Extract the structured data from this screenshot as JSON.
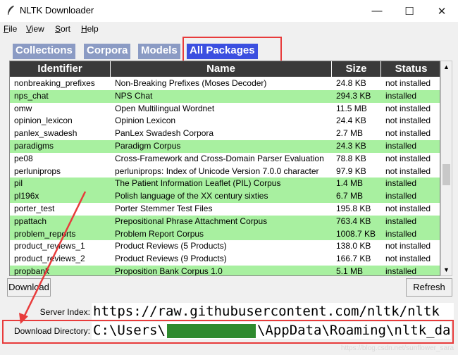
{
  "window": {
    "title": "NLTK Downloader",
    "controls": {
      "minimize": "—",
      "maximize": "☐",
      "close": "✕"
    }
  },
  "menu": [
    "File",
    "View",
    "Sort",
    "Help"
  ],
  "tabs": [
    {
      "label": "Collections",
      "active": false
    },
    {
      "label": "Corpora",
      "active": false
    },
    {
      "label": "Models",
      "active": false
    },
    {
      "label": "All Packages",
      "active": true
    }
  ],
  "table": {
    "columns": [
      "Identifier",
      "Name",
      "Size",
      "Status"
    ],
    "rows": [
      {
        "id": "nonbreaking_prefixes",
        "name": "Non-Breaking Prefixes (Moses Decoder)",
        "size": "24.8 KB",
        "status": "not installed"
      },
      {
        "id": "nps_chat",
        "name": "NPS Chat",
        "size": "294.3 KB",
        "status": "installed"
      },
      {
        "id": "omw",
        "name": "Open Multilingual Wordnet",
        "size": "11.5 MB",
        "status": "not installed"
      },
      {
        "id": "opinion_lexicon",
        "name": "Opinion Lexicon",
        "size": "24.4 KB",
        "status": "not installed"
      },
      {
        "id": "panlex_swadesh",
        "name": "PanLex Swadesh Corpora",
        "size": "2.7 MB",
        "status": "not installed"
      },
      {
        "id": "paradigms",
        "name": "Paradigm Corpus",
        "size": "24.3 KB",
        "status": "installed"
      },
      {
        "id": "pe08",
        "name": "Cross-Framework and Cross-Domain Parser Evaluation",
        "size": "78.8 KB",
        "status": "not installed"
      },
      {
        "id": "perluniprops",
        "name": "perluniprops: Index of Unicode Version 7.0.0 character",
        "size": "97.9 KB",
        "status": "not installed"
      },
      {
        "id": "pil",
        "name": "The Patient Information Leaflet (PIL) Corpus",
        "size": "1.4 MB",
        "status": "installed"
      },
      {
        "id": "pl196x",
        "name": "Polish language of the XX century sixties",
        "size": "6.7 MB",
        "status": "installed"
      },
      {
        "id": "porter_test",
        "name": "Porter Stemmer Test Files",
        "size": "195.8 KB",
        "status": "not installed"
      },
      {
        "id": "ppattach",
        "name": "Prepositional Phrase Attachment Corpus",
        "size": "763.4 KB",
        "status": "installed"
      },
      {
        "id": "problem_reports",
        "name": "Problem Report Corpus",
        "size": "1008.7 KB",
        "status": "installed"
      },
      {
        "id": "product_reviews_1",
        "name": "Product Reviews (5 Products)",
        "size": "138.0 KB",
        "status": "not installed"
      },
      {
        "id": "product_reviews_2",
        "name": "Product Reviews (9 Products)",
        "size": "166.7 KB",
        "status": "not installed"
      },
      {
        "id": "propbank",
        "name": "Proposition Bank Corpus 1.0",
        "size": "5.1 MB",
        "status": "installed"
      }
    ]
  },
  "buttons": {
    "download": "Download",
    "refresh": "Refresh"
  },
  "server_index": {
    "label": "Server Index:",
    "value": "https://raw.githubusercontent.com/nltk/nltk"
  },
  "download_directory": {
    "label": "Download Directory:",
    "prefix": "C:\\Users\\",
    "suffix": "\\AppData\\Roaming\\nltk_da"
  },
  "watermark": "https://blog.csdn.net/sunflower_sara",
  "colors": {
    "tab_active": "#3b4fe0",
    "tab_inactive": "#8b9bc4",
    "installed_row": "#a8f0a0",
    "header": "#3a3a3a",
    "annotation": "#e83b3b"
  }
}
